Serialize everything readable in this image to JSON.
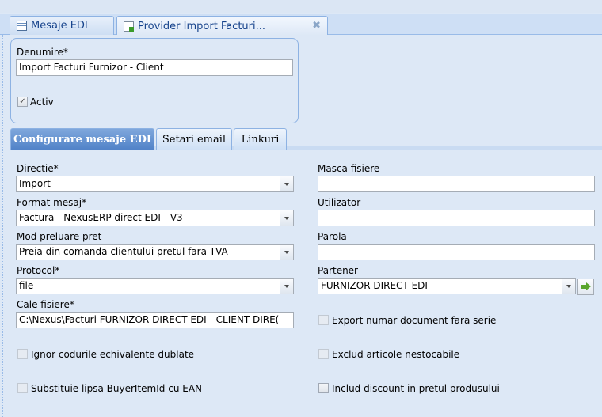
{
  "tabs": [
    {
      "label": "Mesaje EDI",
      "icon": "grid-icon"
    },
    {
      "label": "Provider Import Facturi...",
      "icon": "document-icon"
    }
  ],
  "close_glyph": "✖",
  "header": {
    "name_label": "Denumire*",
    "name_value": "Import Facturi Furnizor - Client",
    "active_label": "Activ",
    "active_checked": true
  },
  "subtabs": [
    {
      "label": "Configurare mesaje EDI",
      "active": true
    },
    {
      "label": "Setari email",
      "active": false
    },
    {
      "label": "Linkuri",
      "active": false
    }
  ],
  "left": {
    "direction_label": "Directie*",
    "direction_value": "Import",
    "format_label": "Format mesaj*",
    "format_value": "Factura - NexusERP direct EDI - V3",
    "price_label": "Mod preluare pret",
    "price_value": "Preia din comanda clientului pretul fara TVA",
    "protocol_label": "Protocol*",
    "protocol_value": "file",
    "path_label": "Cale fisiere*",
    "path_value": "C:\\Nexus\\Facturi FURNIZOR DIRECT EDI - CLIENT DIRE(",
    "ignore_dup_label": "Ignor codurile echivalente dublate",
    "subst_label": "Substituie lipsa BuyerItemId cu EAN"
  },
  "right": {
    "mask_label": "Masca fisiere",
    "mask_value": "",
    "user_label": "Utilizator",
    "user_value": "",
    "password_label": "Parola",
    "password_value": "",
    "partner_label": "Partener",
    "partner_value": "FURNIZOR DIRECT EDI",
    "export_label": "Export numar document fara serie",
    "exclude_label": "Exclud articole nestocabile",
    "include_disc_label": "Includ discount in pretul produsului"
  },
  "checkmark": "✓"
}
